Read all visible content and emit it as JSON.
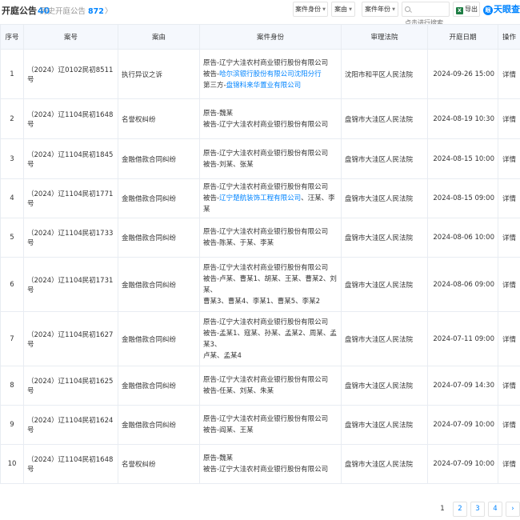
{
  "header": {
    "title": "开庭公告",
    "title_count": "40",
    "history_label": "历史开庭公告",
    "history_count": "872",
    "history_chevron": "〉",
    "filters": [
      {
        "label": "案件身份"
      },
      {
        "label": "案由"
      },
      {
        "label": "案件年份"
      }
    ],
    "search_placeholder": "点击进行搜索",
    "export_label": "导出",
    "export_icon_text": "X",
    "logo_text": "天眼查",
    "logo_icon_text": "眼"
  },
  "table": {
    "columns": [
      "序号",
      "案号",
      "案由",
      "案件身份",
      "审理法院",
      "开庭日期",
      "操作"
    ],
    "rows": [
      {
        "index": "1",
        "case_no": "（2024）辽0102民初8511号",
        "cause": "执行异议之诉",
        "parties": [
          {
            "prefix": "原告-",
            "names": [
              {
                "text": "辽宁大洼农村商业银行股份有限公司",
                "link": false
              }
            ]
          },
          {
            "prefix": "被告-",
            "names": [
              {
                "text": "哈尔滨银行股份有限公司沈阳分行",
                "link": true
              }
            ]
          },
          {
            "prefix": "第三方-",
            "names": [
              {
                "text": "盘锦科来华置业有限公司",
                "link": true
              }
            ]
          }
        ],
        "court": "沈阳市和平区人民法院",
        "date": "2024-09-26 15:00",
        "action": "详情"
      },
      {
        "index": "2",
        "case_no": "（2024）辽1104民初1648号",
        "cause": "名誉权纠纷",
        "parties": [
          {
            "prefix": "原告-",
            "names": [
              {
                "text": "魏某",
                "link": false
              }
            ]
          },
          {
            "prefix": "被告-",
            "names": [
              {
                "text": "辽宁大洼农村商业银行股份有限公司",
                "link": false
              }
            ]
          }
        ],
        "court": "盘锦市大洼区人民法院",
        "date": "2024-08-19 10:30",
        "action": "详情"
      },
      {
        "index": "3",
        "case_no": "（2024）辽1104民初1845号",
        "cause": "金融借款合同纠纷",
        "parties": [
          {
            "prefix": "原告-",
            "names": [
              {
                "text": "辽宁大洼农村商业银行股份有限公司",
                "link": false
              }
            ]
          },
          {
            "prefix": "被告-",
            "names": [
              {
                "text": "刘某、张某",
                "link": false
              }
            ]
          }
        ],
        "court": "盘锦市大洼区人民法院",
        "date": "2024-08-15 10:00",
        "action": "详情"
      },
      {
        "index": "4",
        "case_no": "（2024）辽1104民初1771号",
        "cause": "金融借款合同纠纷",
        "parties": [
          {
            "prefix": "原告-",
            "names": [
              {
                "text": "辽宁大洼农村商业银行股份有限公司",
                "link": false
              }
            ]
          },
          {
            "prefix": "被告-",
            "names": [
              {
                "text": "辽宁楚航装饰工程有限公司",
                "link": true
              },
              {
                "text": "、汪某、李某",
                "link": false
              }
            ]
          }
        ],
        "court": "盘锦市大洼区人民法院",
        "date": "2024-08-15 09:00",
        "action": "详情"
      },
      {
        "index": "5",
        "case_no": "（2024）辽1104民初1733号",
        "cause": "金融借款合同纠纷",
        "parties": [
          {
            "prefix": "原告-",
            "names": [
              {
                "text": "辽宁大洼农村商业银行股份有限公司",
                "link": false
              }
            ]
          },
          {
            "prefix": "被告-",
            "names": [
              {
                "text": "陈某、于某、李某",
                "link": false
              }
            ]
          }
        ],
        "court": "盘锦市大洼区人民法院",
        "date": "2024-08-06 10:00",
        "action": "详情"
      },
      {
        "index": "6",
        "case_no": "（2024）辽1104民初1731号",
        "cause": "金融借款合同纠纷",
        "parties": [
          {
            "prefix": "原告-",
            "names": [
              {
                "text": "辽宁大洼农村商业银行股份有限公司",
                "link": false
              }
            ]
          },
          {
            "prefix": "被告-",
            "names": [
              {
                "text": "卢某、曹某1、胡某、王某、曹某2、刘某、",
                "link": false
              }
            ]
          },
          {
            "prefix": "",
            "names": [
              {
                "text": "曹某3、曹某4、李某1、曹某5、李某2",
                "link": false
              }
            ]
          }
        ],
        "court": "盘锦市大洼区人民法院",
        "date": "2024-08-06 09:00",
        "action": "详情"
      },
      {
        "index": "7",
        "case_no": "（2024）辽1104民初1627号",
        "cause": "金融借款合同纠纷",
        "parties": [
          {
            "prefix": "原告-",
            "names": [
              {
                "text": "辽宁大洼农村商业银行股份有限公司",
                "link": false
              }
            ]
          },
          {
            "prefix": "被告-",
            "names": [
              {
                "text": "孟某1、寇某、孙某、孟某2、周某、孟某3、",
                "link": false
              }
            ]
          },
          {
            "prefix": "",
            "names": [
              {
                "text": "卢某、孟某4",
                "link": false
              }
            ]
          }
        ],
        "court": "盘锦市大洼区人民法院",
        "date": "2024-07-11 09:00",
        "action": "详情"
      },
      {
        "index": "8",
        "case_no": "（2024）辽1104民初1625号",
        "cause": "金融借款合同纠纷",
        "parties": [
          {
            "prefix": "原告-",
            "names": [
              {
                "text": "辽宁大洼农村商业银行股份有限公司",
                "link": false
              }
            ]
          },
          {
            "prefix": "被告-",
            "names": [
              {
                "text": "任某、刘某、朱某",
                "link": false
              }
            ]
          }
        ],
        "court": "盘锦市大洼区人民法院",
        "date": "2024-07-09 14:30",
        "action": "详情"
      },
      {
        "index": "9",
        "case_no": "（2024）辽1104民初1624号",
        "cause": "金融借款合同纠纷",
        "parties": [
          {
            "prefix": "原告-",
            "names": [
              {
                "text": "辽宁大洼农村商业银行股份有限公司",
                "link": false
              }
            ]
          },
          {
            "prefix": "被告-",
            "names": [
              {
                "text": "阎某、王某",
                "link": false
              }
            ]
          }
        ],
        "court": "盘锦市大洼区人民法院",
        "date": "2024-07-09 10:00",
        "action": "详情"
      },
      {
        "index": "10",
        "case_no": "（2024）辽1104民初1648号",
        "cause": "名誉权纠纷",
        "parties": [
          {
            "prefix": "原告-",
            "names": [
              {
                "text": "魏某",
                "link": false
              }
            ]
          },
          {
            "prefix": "被告-",
            "names": [
              {
                "text": "辽宁大洼农村商业银行股份有限公司",
                "link": false
              }
            ]
          }
        ],
        "court": "盘锦市大洼区人民法院",
        "date": "2024-07-09 10:00",
        "action": "详情"
      }
    ]
  },
  "pagination": {
    "pages": [
      "1",
      "2",
      "3",
      "4"
    ],
    "current": "1",
    "next": "›"
  },
  "colors": {
    "accent": "#0084ff",
    "header_bg": "#f5f8fd",
    "border": "#e8ecf2"
  }
}
